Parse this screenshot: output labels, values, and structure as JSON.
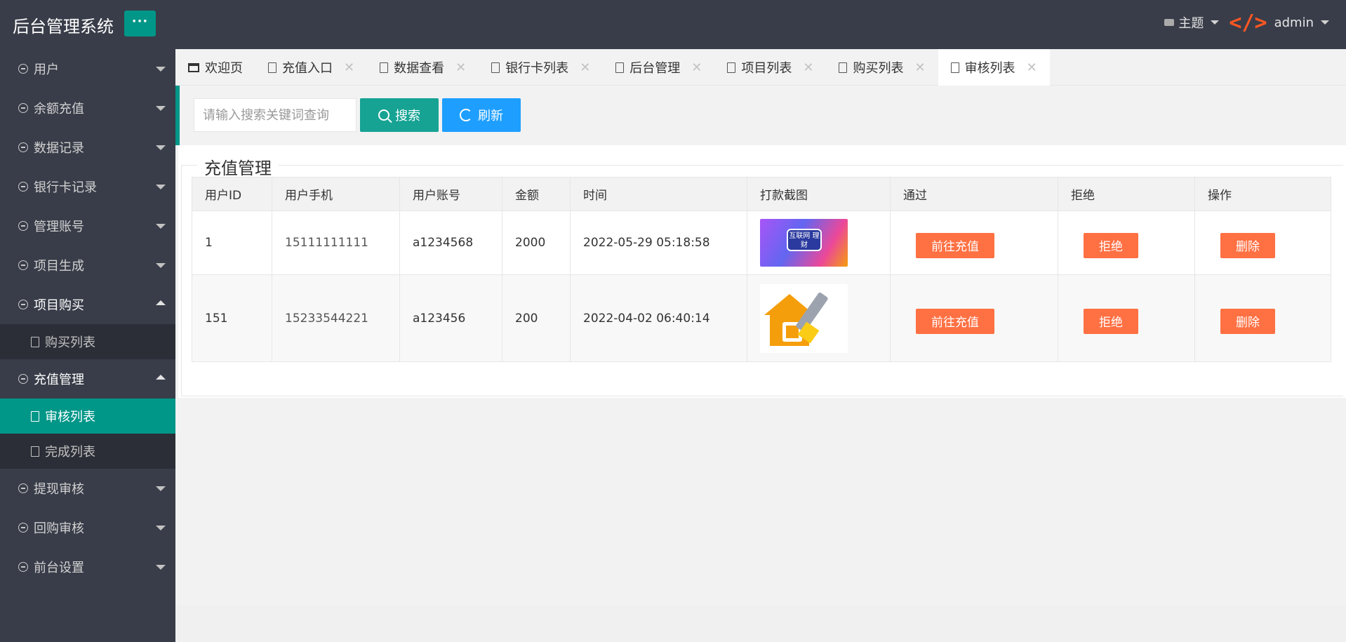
{
  "header": {
    "title": "后台管理系统",
    "menu_toggle": "···",
    "theme_label": "主题",
    "user_label": "admin",
    "code_glyph": "</>"
  },
  "sidebar": {
    "items": [
      {
        "label": "用户",
        "state": "collapsed"
      },
      {
        "label": "余额充值",
        "state": "collapsed"
      },
      {
        "label": "数据记录",
        "state": "collapsed"
      },
      {
        "label": "银行卡记录",
        "state": "collapsed"
      },
      {
        "label": "管理账号",
        "state": "collapsed"
      },
      {
        "label": "项目生成",
        "state": "collapsed"
      },
      {
        "label": "项目购买",
        "state": "open",
        "children": [
          {
            "label": "购买列表"
          }
        ]
      },
      {
        "label": "充值管理",
        "state": "open",
        "children": [
          {
            "label": "审核列表",
            "active": true
          },
          {
            "label": "完成列表"
          }
        ]
      },
      {
        "label": "提现审核",
        "state": "collapsed"
      },
      {
        "label": "回购审核",
        "state": "collapsed"
      },
      {
        "label": "前台设置",
        "state": "collapsed"
      }
    ]
  },
  "tabs": [
    {
      "label": "欢迎页",
      "closable": false
    },
    {
      "label": "充值入口",
      "closable": true
    },
    {
      "label": "数据查看",
      "closable": true
    },
    {
      "label": "银行卡列表",
      "closable": true
    },
    {
      "label": "后台管理",
      "closable": true
    },
    {
      "label": "项目列表",
      "closable": true
    },
    {
      "label": "购买列表",
      "closable": true
    },
    {
      "label": "审核列表",
      "closable": true,
      "active": true
    }
  ],
  "toolbar": {
    "search_placeholder": "请输入搜索关键词查询",
    "search_label": "搜索",
    "refresh_label": "刷新"
  },
  "panel": {
    "title": "充值管理"
  },
  "table": {
    "headers": [
      "用户ID",
      "用户手机",
      "用户账号",
      "金额",
      "时间",
      "打款截图",
      "通过",
      "拒绝",
      "操作"
    ],
    "rows": [
      {
        "id": "1",
        "phone": "15111111111",
        "account": "a1234568",
        "amount": "2000",
        "time": "2022-05-29 05:18:58",
        "approve": "前往充值",
        "reject": "拒绝",
        "delete": "删除",
        "screenshot_text": "互联网\n理财"
      },
      {
        "id": "151",
        "phone": "15233544221",
        "account": "a123456",
        "amount": "200",
        "time": "2022-04-02 06:40:14",
        "approve": "前往充值",
        "reject": "拒绝",
        "delete": "删除"
      }
    ]
  },
  "colors": {
    "header_bg": "#393d49",
    "accent": "#009688",
    "primary_blue": "#1e9fff",
    "warm_button": "#ff7043"
  }
}
